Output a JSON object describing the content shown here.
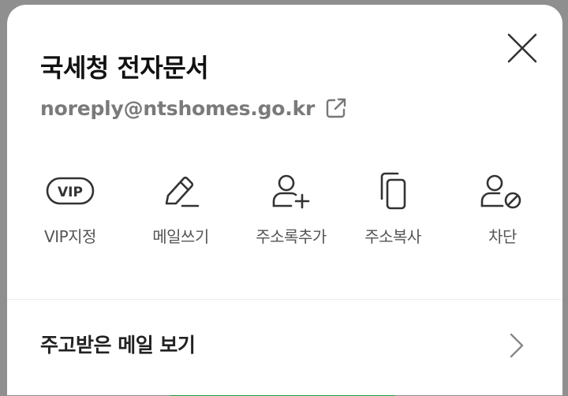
{
  "sender": {
    "name": "국세청 전자문서",
    "email": "noreply@ntshomes.go.kr"
  },
  "actions": [
    {
      "id": "vip",
      "label": "VIP지정",
      "icon": "vip-icon"
    },
    {
      "id": "write",
      "label": "메일쓰기",
      "icon": "pencil-icon"
    },
    {
      "id": "add-contact",
      "label": "주소록추가",
      "icon": "person-add-icon"
    },
    {
      "id": "copy-address",
      "label": "주소복사",
      "icon": "copy-icon"
    },
    {
      "id": "block",
      "label": "차단",
      "icon": "person-block-icon"
    }
  ],
  "received": {
    "label": "주고받은 메일 보기"
  },
  "colors": {
    "accent_green": "#1f9d3f",
    "text_primary": "#111111",
    "text_secondary": "#7a7a7a"
  }
}
